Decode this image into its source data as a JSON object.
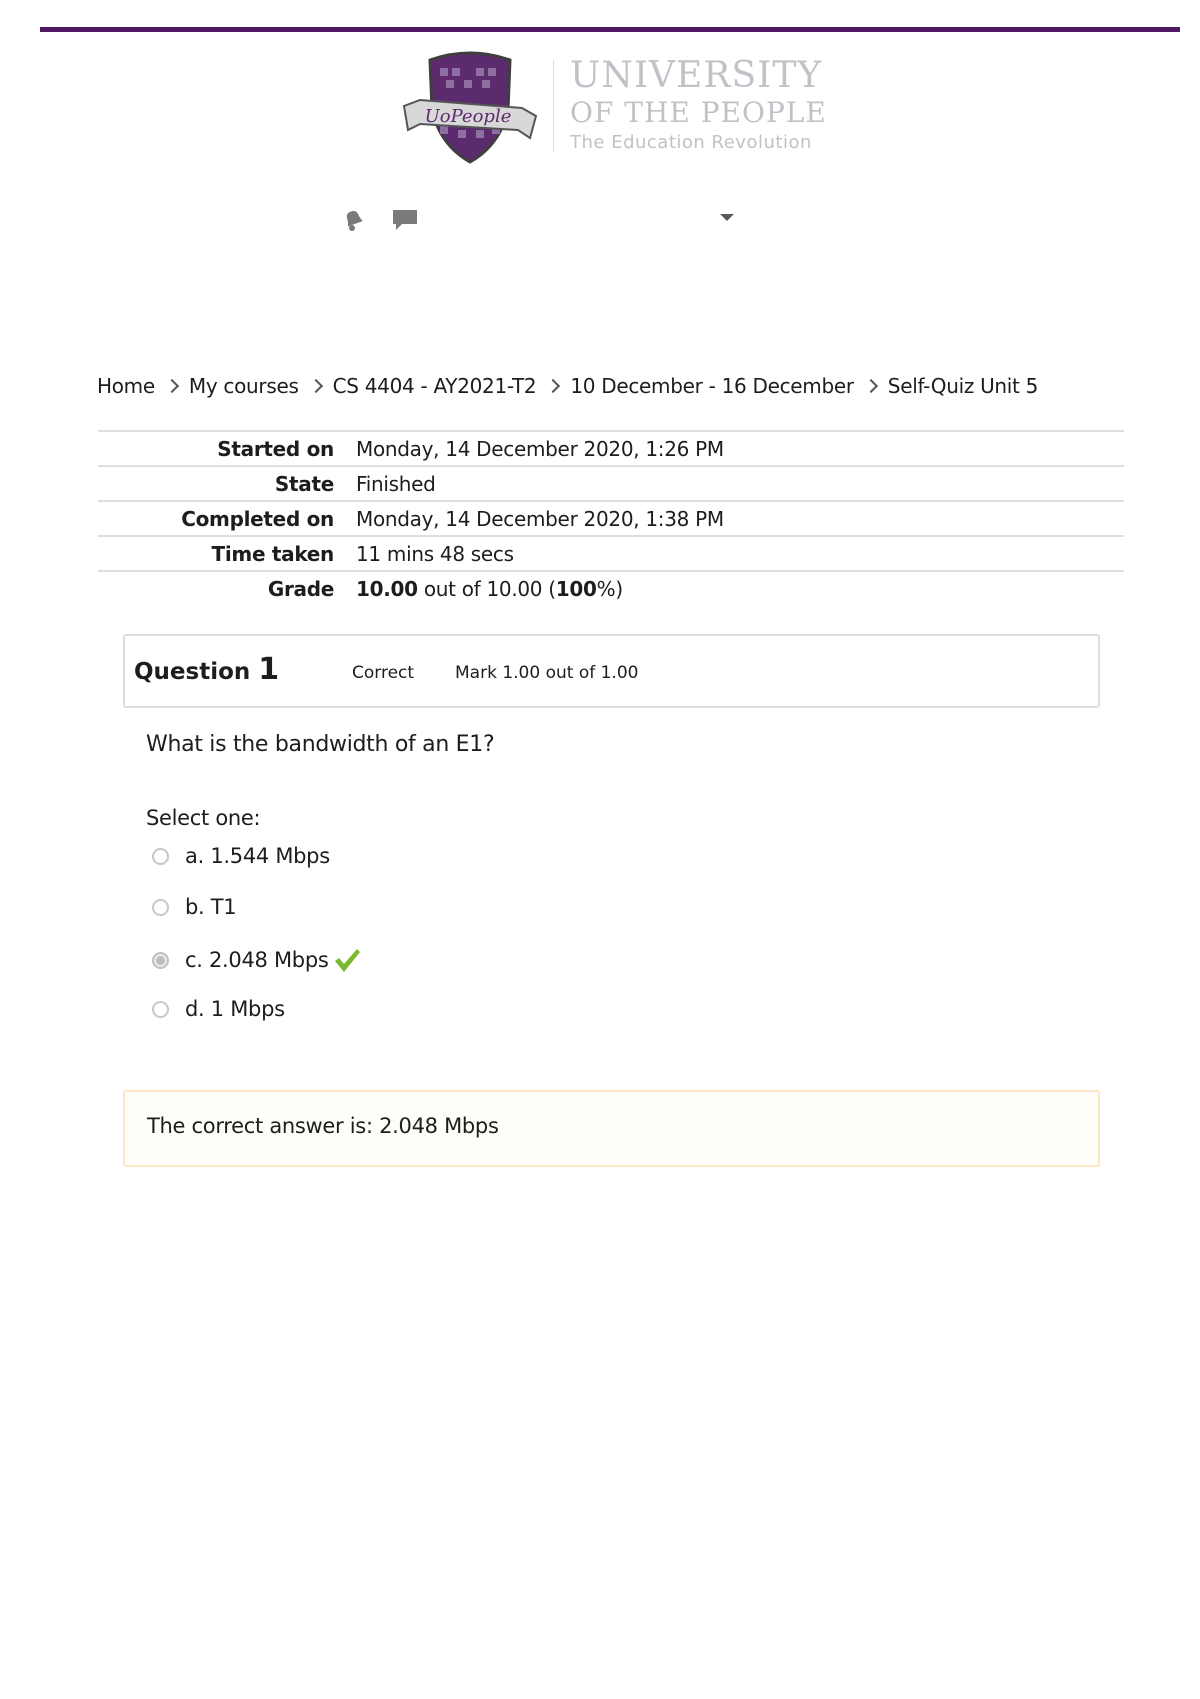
{
  "logo": {
    "badge_text": "UoPeople",
    "line1": "UNIVERSITY",
    "line2": "OF THE PEOPLE",
    "line3": "The Education Revolution"
  },
  "nav": {
    "icons": [
      "bell-icon",
      "chat-icon",
      "caret-down-icon"
    ]
  },
  "breadcrumb": [
    "Home",
    "My courses",
    "CS 4404 - AY2021-T2",
    "10 December - 16 December",
    "Self-Quiz Unit 5"
  ],
  "summary": {
    "started_label": "Started on",
    "started_value": "Monday, 14 December 2020, 1:26 PM",
    "state_label": "State",
    "state_value": "Finished",
    "completed_label": "Completed on",
    "completed_value": "Monday, 14 December 2020, 1:38 PM",
    "time_label": "Time taken",
    "time_value": "11 mins 48 secs",
    "grade_label": "Grade",
    "grade_score": "10.00",
    "grade_out_of": " out of 10.00 (",
    "grade_percent": "100",
    "grade_suffix": "%)"
  },
  "question": {
    "label": "Question",
    "number": "1",
    "state": "Correct",
    "mark": "Mark 1.00 out of 1.00",
    "text": "What is the bandwidth of an E1?",
    "prompt": "Select one:",
    "options": [
      {
        "label": "a. 1.544 Mbps",
        "selected": false
      },
      {
        "label": "b. T1",
        "selected": false
      },
      {
        "label": "c. 2.048 Mbps",
        "selected": true,
        "correct_mark": "check-icon"
      },
      {
        "label": "d. 1 Mbps",
        "selected": false
      }
    ],
    "feedback": "The correct answer is: 2.048 Mbps"
  },
  "colors": {
    "brand_purple": "#4f1a63",
    "check_green": "#7cb82f",
    "feedback_border": "#fbe6c7"
  }
}
